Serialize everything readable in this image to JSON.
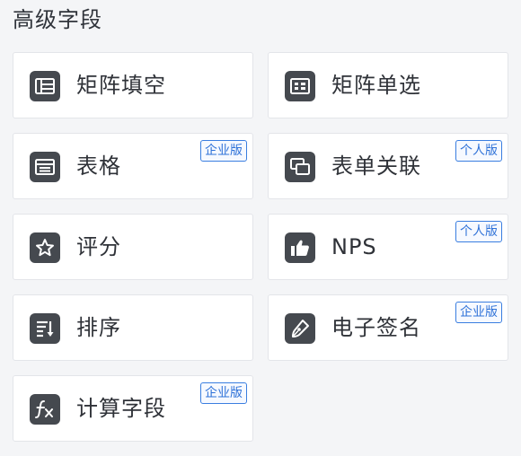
{
  "section": {
    "title": "高级字段"
  },
  "fields": [
    {
      "label": "矩阵填空",
      "icon": "matrix-fill-icon",
      "badge": null
    },
    {
      "label": "矩阵单选",
      "icon": "matrix-radio-icon",
      "badge": null
    },
    {
      "label": "表格",
      "icon": "table-icon",
      "badge": "企业版"
    },
    {
      "label": "表单关联",
      "icon": "form-link-icon",
      "badge": "个人版"
    },
    {
      "label": "评分",
      "icon": "star-rating-icon",
      "badge": null
    },
    {
      "label": "NPS",
      "icon": "thumbs-up-icon",
      "badge": "个人版"
    },
    {
      "label": "排序",
      "icon": "sort-icon",
      "badge": null
    },
    {
      "label": "电子签名",
      "icon": "signature-pen-icon",
      "badge": "企业版"
    },
    {
      "label": "计算字段",
      "icon": "formula-icon",
      "badge": "企业版"
    }
  ],
  "colors": {
    "background": "#f4f5f7",
    "card": "#ffffff",
    "card_border": "#e3e5e9",
    "icon_bg": "#45494f",
    "badge_blue": "#2f72d8"
  }
}
